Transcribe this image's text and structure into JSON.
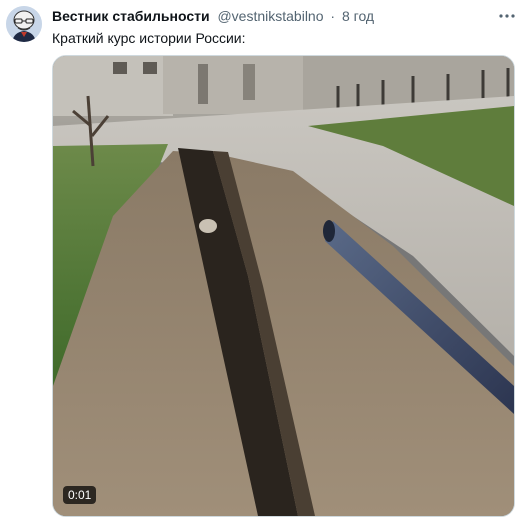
{
  "tweet": {
    "display_name": "Вестник стабильности",
    "handle": "@vestnikstabilno",
    "separator": "·",
    "time": "8 год",
    "text": "Краткий курс истории России:",
    "video": {
      "duration": "0:01"
    },
    "icons": {
      "avatar": "avatar-caricature-icon",
      "more": "more-dots-icon"
    }
  }
}
